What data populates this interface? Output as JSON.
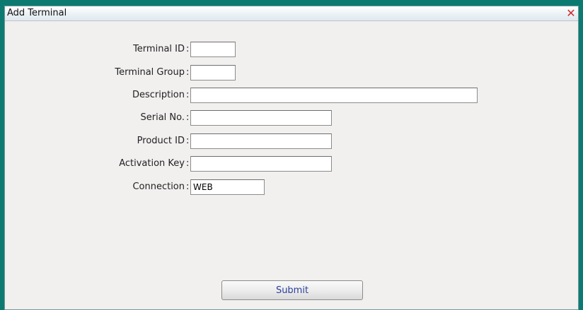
{
  "window": {
    "title": "Add Terminal",
    "close_glyph": "✕"
  },
  "form": {
    "terminal_id": {
      "label": "Terminal ID",
      "value": ""
    },
    "terminal_group": {
      "label": "Terminal Group",
      "value": ""
    },
    "description": {
      "label": "Description",
      "value": ""
    },
    "serial_no": {
      "label": "Serial No.",
      "value": ""
    },
    "product_id": {
      "label": "Product ID",
      "value": ""
    },
    "activation_key": {
      "label": "Activation Key",
      "value": ""
    },
    "connection": {
      "label": "Connection",
      "value": "WEB"
    },
    "separator": ":"
  },
  "actions": {
    "submit_label": "Submit"
  },
  "colors": {
    "frame": "#0d7a72",
    "background": "#f2efef",
    "close": "#d02a2a",
    "submit_text": "#2a3f9c"
  }
}
